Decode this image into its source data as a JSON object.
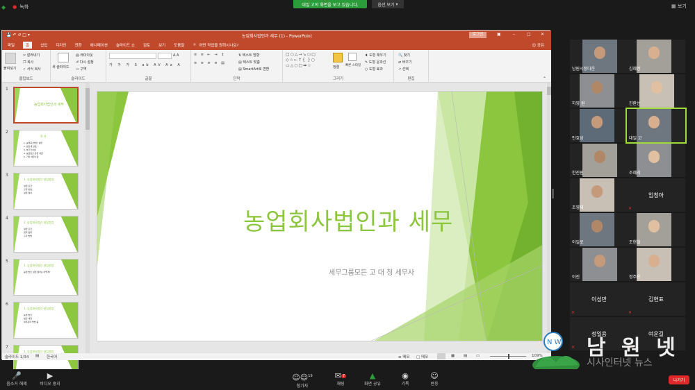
{
  "zoom": {
    "recording_label": "녹화",
    "share_banner": "대일 고의 화면을 보고 있습니다.",
    "view_options": "옵션 보기",
    "gallery_view": "보기",
    "toolbar": [
      {
        "label": "음소거 해제",
        "icon": "mic-muted-icon"
      },
      {
        "label": "비디오 중지",
        "icon": "video-icon"
      },
      {
        "label": "참가자",
        "icon": "participants-icon",
        "count": "19"
      },
      {
        "label": "채팅",
        "icon": "chat-icon",
        "badge": "7"
      },
      {
        "label": "화면 공유",
        "icon": "share-screen-icon"
      },
      {
        "label": "기록",
        "icon": "record-icon"
      },
      {
        "label": "반응",
        "icon": "reaction-icon"
      }
    ],
    "leave": "나가기",
    "accent": "#2a9d3a",
    "danger": "#e02828"
  },
  "ppt": {
    "window_title": "농업회사법인과 세무 (1)  -  PowerPoint",
    "signin": "로그인",
    "tabs": [
      "파일",
      "홈",
      "삽입",
      "디자인",
      "전환",
      "애니메이션",
      "슬라이드 쇼",
      "검토",
      "보기",
      "도움말"
    ],
    "tell_me": "어떤 작업을 원하시나요?",
    "share": "공유",
    "groups": {
      "clipboard": "클립보드",
      "slides": "슬라이드",
      "font": "글꼴",
      "paragraph": "단락",
      "drawing": "그리기",
      "editing": "편집"
    },
    "ribbon_items": {
      "paste": "붙여넣기",
      "cut": "잘라내기",
      "copy": "복사",
      "format_painter": "서식 복사",
      "new_slide": "새 슬라이드",
      "layout": "레이아웃",
      "reset": "다시 설정",
      "section": "구역",
      "text_dir": "텍스트 방향",
      "align_text": "텍스트 맞춤",
      "smartart": "SmartArt로 변환",
      "arrange": "정렬",
      "quick_styles": "빠른 스타일",
      "shape_fill": "도형 채우기",
      "shape_outline": "도형 윤곽선",
      "shape_effects": "도형 효과",
      "find": "찾기",
      "replace": "바꾸기",
      "select": "선택"
    },
    "thumbnails": [
      {
        "n": "1",
        "title": "농업회사법인과 세무",
        "lines": []
      },
      {
        "n": "2",
        "title": "목   차",
        "lines": [
          "1. 농업회사법인 설립",
          "2. 법인세 감면",
          "3. 부가가치세",
          "4. 농업법인 관련 세금",
          "5. 기타 세무사항"
        ]
      },
      {
        "n": "3",
        "title": "1. 농업회사법인 설립방법",
        "lines": [
          "설립 요건",
          "출자 방법",
          "설립 절차"
        ]
      },
      {
        "n": "4",
        "title": "1. 농업회사법인 설립방법",
        "lines": [
          "설립 요건",
          "업무 범위",
          "출자 방법"
        ]
      },
      {
        "n": "5",
        "title": "1. 농업회사법인 설립방법",
        "lines": [
          "농업 법인 설립 절차는 어떻게?"
        ]
      },
      {
        "n": "6",
        "title": "1. 농업회사법인 설립방법",
        "lines": [
          "농업 법인",
          "법인 세금",
          "세무관리 방법 등"
        ]
      },
      {
        "n": "7",
        "title": "1. 농업회사법인 설립방법",
        "lines": []
      }
    ],
    "slide_title": "농업회사법인과 세무",
    "slide_subtitle": "세무그룹모든 고 대 청 세무사",
    "status_slide": "슬라이드 1/34",
    "status_lang": "한국어",
    "status_notes": "메모",
    "status_comments": "메모",
    "zoom_level": "109%",
    "accent": "#c0482b",
    "slide_green": "#8cc63e"
  },
  "participants": [
    {
      "name": "남원시정다운",
      "video": true
    },
    {
      "name": "김혜정",
      "video": true
    },
    {
      "name": "하영 원",
      "video": true
    },
    {
      "name": "진환선",
      "video": true
    },
    {
      "name": "안효성",
      "video": true
    },
    {
      "name": "대일 고",
      "video": true,
      "active": true
    },
    {
      "name": "한진원",
      "video": true
    },
    {
      "name": "조혜리",
      "video": true
    },
    {
      "name": "조영재",
      "video": true
    },
    {
      "name": "임청아",
      "video": false
    },
    {
      "name": "이일로",
      "video": true
    },
    {
      "name": "조현철",
      "video": true
    },
    {
      "name": "이진",
      "video": true
    },
    {
      "name": "정주용",
      "video": true
    },
    {
      "name": "이성만",
      "video": false
    },
    {
      "name": "김현표",
      "video": false
    },
    {
      "name": "정일용",
      "video": false
    },
    {
      "name": "여운길",
      "video": false
    }
  ],
  "watermark": {
    "brand": "남 원 넷",
    "sub": "시사인터넷 뉴스",
    "logo_text": "N W"
  }
}
